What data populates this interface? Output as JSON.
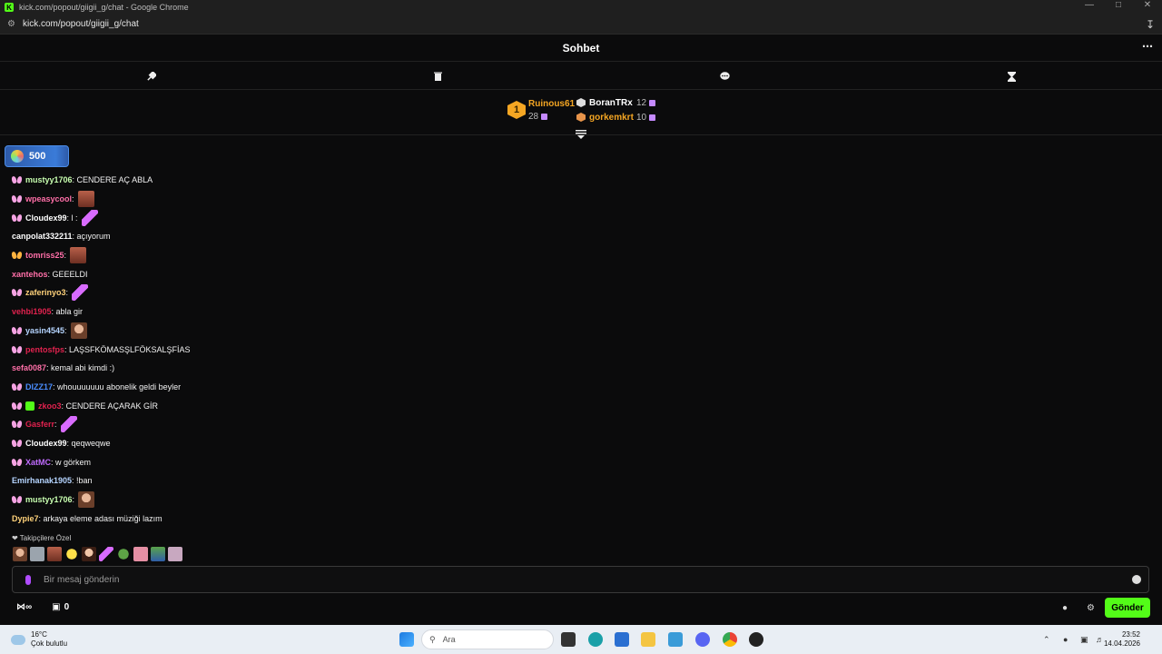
{
  "browser": {
    "window_title": "kick.com/popout/giigii_g/chat - Google Chrome",
    "url": "kick.com/popout/giigii_g/chat"
  },
  "chat": {
    "title": "Sohbet",
    "pinned_amount": "500",
    "leaderboard": {
      "first": {
        "rank": "1",
        "name": "Ruinous61",
        "count": "28"
      },
      "second": {
        "name": "BoranTRx",
        "count": "12"
      },
      "third": {
        "name": "gorkemkrt",
        "count": "10"
      }
    },
    "messages": [
      {
        "badge": "pink",
        "user": "mustyy1706",
        "color": "#c8ffb0",
        "text": ": CENDERE AÇ ABLA",
        "emote": ""
      },
      {
        "badge": "pink",
        "user": "wpeasycool",
        "color": "#ff6fa8",
        "text": ":",
        "emote": "photo"
      },
      {
        "badge": "pink",
        "user": "Cloudex99",
        "color": "#ffffff",
        "text": ": l :",
        "emote": "feather"
      },
      {
        "badge": "",
        "user": "canpolat332211",
        "color": "#ffffff",
        "text": ": açıyorum",
        "emote": ""
      },
      {
        "badge": "orange",
        "user": "tomriss25",
        "color": "#ff6fa8",
        "text": ":",
        "emote": "photo"
      },
      {
        "badge": "",
        "user": "xantehos",
        "color": "#ff6fa8",
        "text": ": GEEELDI",
        "emote": ""
      },
      {
        "badge": "pink",
        "user": "zaferinyo3",
        "color": "#ffd27a",
        "text": ":",
        "emote": "feather"
      },
      {
        "badge": "",
        "user": "vehbi1905",
        "color": "#e0224e",
        "text": ": abla gir",
        "emote": ""
      },
      {
        "badge": "pink",
        "user": "yasin4545",
        "color": "#b5d4ff",
        "text": ":",
        "emote": "face"
      },
      {
        "badge": "pink",
        "user": "pentosfps",
        "color": "#e0224e",
        "text": ": LAŞSFKÖMASŞLFÖKSALŞFİAS",
        "emote": ""
      },
      {
        "badge": "",
        "user": "sefa0087",
        "color": "#ff6fa8",
        "text": ": kemal abi kimdi :)",
        "emote": ""
      },
      {
        "badge": "pink",
        "user": "DIZZ17",
        "color": "#4a8dff",
        "text": ": whouuuuuuu abonelik geldi beyler",
        "emote": ""
      },
      {
        "badge": "pink+green",
        "user": "zkoo3",
        "color": "#e0224e",
        "text": ": CENDERE AÇARAK GİR",
        "emote": ""
      },
      {
        "badge": "pink",
        "user": "Gasferr",
        "color": "#e0224e",
        "text": ":",
        "emote": "feather"
      },
      {
        "badge": "pink",
        "user": "Cloudex99",
        "color": "#ffffff",
        "text": ": qeqweqwe",
        "emote": ""
      },
      {
        "badge": "pink",
        "user": "XatMC",
        "color": "#c06bff",
        "text": ": w görkem",
        "emote": ""
      },
      {
        "badge": "",
        "user": "Emirhanak1905",
        "color": "#b5d4ff",
        "text": ": !ban",
        "emote": ""
      },
      {
        "badge": "pink",
        "user": "mustyy1706",
        "color": "#c8ffb0",
        "text": ":",
        "emote": "face"
      },
      {
        "badge": "",
        "user": "Dypie7",
        "color": "#ffd27a",
        "text": ": arkaya eleme adası müziği lazım",
        "emote": ""
      }
    ],
    "followers_only_label": "Takipçilere Özel",
    "input_placeholder": "Bir mesaj gönderin",
    "points": "0",
    "send_label": "Gönder"
  },
  "taskbar": {
    "temperature": "16°C",
    "weather": "Çok bulutlu",
    "search_placeholder": "Ara",
    "time": "23:52",
    "date": "14.04.2026"
  }
}
